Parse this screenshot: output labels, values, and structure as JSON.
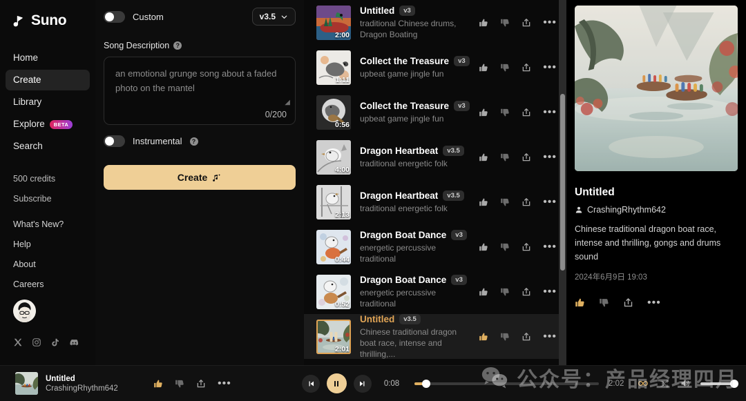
{
  "brand": {
    "name": "Suno",
    "logo_icon": "suno-logo-icon"
  },
  "sidebar": {
    "nav": [
      {
        "label": "Home",
        "active": false
      },
      {
        "label": "Create",
        "active": true
      },
      {
        "label": "Library",
        "active": false
      },
      {
        "label": "Explore",
        "active": false,
        "badge": "BETA"
      },
      {
        "label": "Search",
        "active": false
      }
    ],
    "credits": "500 credits",
    "subscribe": "Subscribe",
    "links": [
      "What's New?",
      "Help",
      "About",
      "Careers"
    ],
    "socials": [
      "x-icon",
      "instagram-icon",
      "tiktok-icon",
      "discord-icon"
    ]
  },
  "create": {
    "custom_label": "Custom",
    "custom_on": false,
    "version": "v3.5",
    "version_caret_icon": "chevron-down-icon",
    "song_description_label": "Song Description",
    "help_icon": "help-circle-icon",
    "description_value": "an emotional grunge song about a faded photo on the mantel",
    "description_placeholder": "an emotional grunge song about a faded photo on the mantel",
    "counter": "0/200",
    "instrumental_label": "Instrumental",
    "instrumental_on": false,
    "create_button": "Create",
    "create_button_icon": "music-note-sparkle-icon",
    "accent_color": "#efcf96"
  },
  "songs": [
    {
      "title": "Untitled",
      "version": "v3",
      "subtitle": "traditional Chinese drums, Dragon Boating",
      "duration": "2:00",
      "selected": false,
      "liked": false
    },
    {
      "title": "Collect the Treasure",
      "version": "v3",
      "subtitle": "upbeat game jingle fun",
      "duration": "1:11",
      "selected": false,
      "liked": false
    },
    {
      "title": "Collect the Treasure",
      "version": "v3",
      "subtitle": "upbeat game jingle fun",
      "duration": "0:56",
      "selected": false,
      "liked": false
    },
    {
      "title": "Dragon Heartbeat",
      "version": "v3.5",
      "subtitle": "traditional energetic folk",
      "duration": "4:00",
      "selected": false,
      "liked": false
    },
    {
      "title": "Dragon Heartbeat",
      "version": "v3.5",
      "subtitle": "traditional energetic folk",
      "duration": "2:13",
      "selected": false,
      "liked": false
    },
    {
      "title": "Dragon Boat Dance",
      "version": "v3",
      "subtitle": "energetic percussive traditional",
      "duration": "0:44",
      "selected": false,
      "liked": false
    },
    {
      "title": "Dragon Boat Dance",
      "version": "v3",
      "subtitle": "energetic percussive traditional",
      "duration": "0:52",
      "selected": false,
      "liked": false
    },
    {
      "title": "Untitled",
      "version": "v3.5",
      "subtitle": "Chinese traditional dragon boat race, intense and thrilling,...",
      "duration": "2:01",
      "selected": true,
      "liked": true
    }
  ],
  "row_actions": {
    "like_icon": "thumbs-up-icon",
    "dislike_icon": "thumbs-down-icon",
    "share_icon": "share-icon",
    "more_icon": "more-options-icon"
  },
  "detail": {
    "title": "Untitled",
    "user_icon": "user-icon",
    "user": "CrashingRhythm642",
    "description": "Chinese traditional dragon boat race, intense and thrilling, gongs and drums sound",
    "date": "2024年6月9日 19:03"
  },
  "player": {
    "title": "Untitled",
    "user": "CrashingRhythm642",
    "current_time": "0:08",
    "total_time": "2:02",
    "progress_percent": 6.6,
    "playing": true,
    "prev_icon": "skip-previous-icon",
    "play_pause_icon": "pause-icon",
    "next_icon": "skip-next-icon",
    "loop_icon": "loop-infinite-icon",
    "shuffle_icon": "shuffle-icon",
    "volume_icon": "volume-icon",
    "volume_percent": 100
  },
  "watermark": {
    "icon": "wechat-icon",
    "text": "公众号：产品经理四月"
  }
}
